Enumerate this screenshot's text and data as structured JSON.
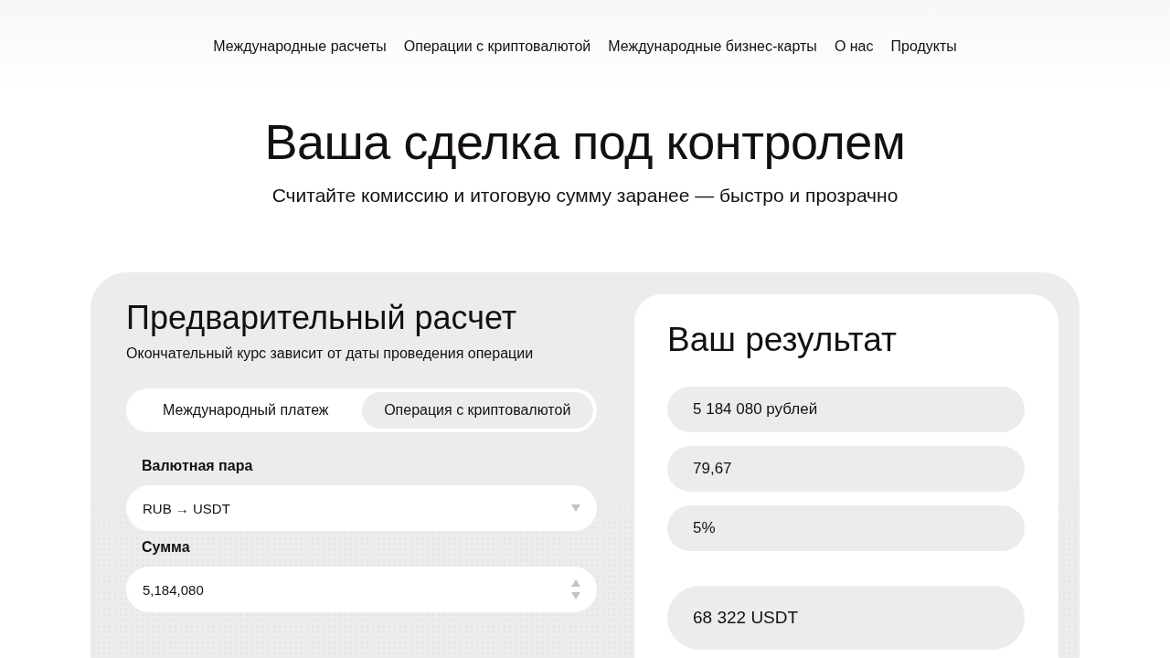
{
  "nav": {
    "items": [
      "Международные расчеты",
      "Операции с криптовалютой",
      "Международные бизнес-карты",
      "О нас",
      "Продукты"
    ]
  },
  "hero": {
    "title": "Ваша сделка под контролем",
    "subtitle": "Считайте комиссию и итоговую сумму заранее — быстро и прозрачно"
  },
  "calculator": {
    "title": "Предварительный расчет",
    "note": "Окончательный курс зависит от даты проведения операции",
    "tabs": [
      {
        "label": "Международный платеж",
        "selected": false
      },
      {
        "label": "Операция с криптовалютой",
        "selected": true
      }
    ],
    "fields": [
      {
        "kind": "select",
        "label": "Валютная пара",
        "value": "RUB → USDT"
      },
      {
        "kind": "number",
        "label": "Сумма",
        "value": "5,184,080"
      }
    ]
  },
  "result": {
    "title": "Ваш результат",
    "values": [
      "5 184 080 рублей",
      "79,67",
      "5%"
    ],
    "total": "68 322 USDT"
  }
}
